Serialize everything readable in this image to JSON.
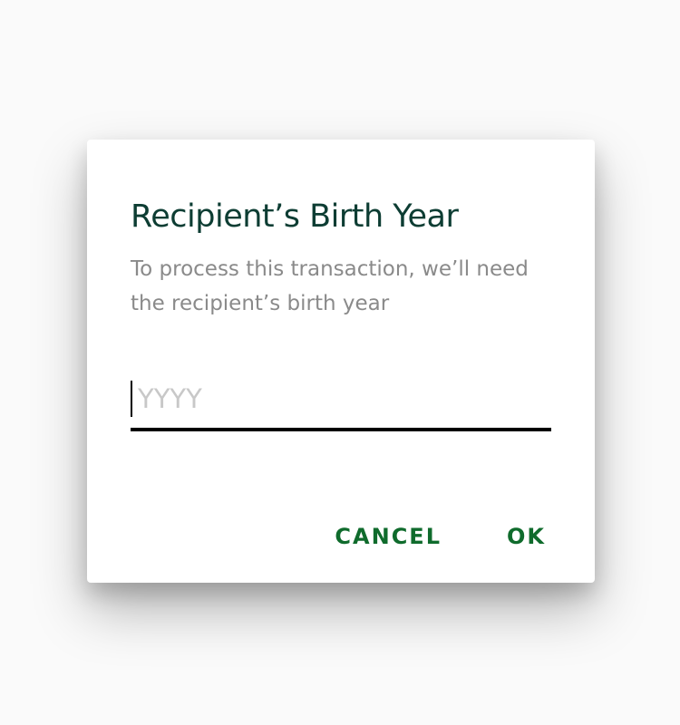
{
  "dialog": {
    "title": "Recipient’s Birth Year",
    "message": "To process this transaction, we’ll need the recipient’s birth year",
    "input": {
      "value": "",
      "placeholder": "YYYY"
    },
    "actions": {
      "cancel_label": "CANCEL",
      "ok_label": "OK"
    }
  },
  "colors": {
    "title": "#0d3d33",
    "message": "#8a8a8a",
    "placeholder": "#c8c8c8",
    "button": "#0f6b2c",
    "underline": "#000000"
  }
}
